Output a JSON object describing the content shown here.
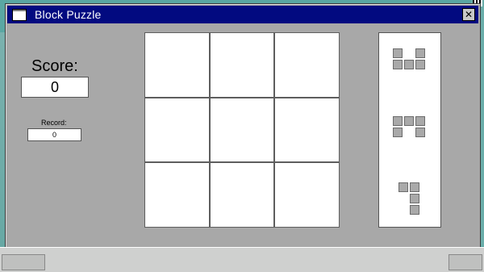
{
  "window": {
    "title": "Block Puzzle",
    "close_glyph": "✕"
  },
  "score": {
    "label": "Score:",
    "value": "0"
  },
  "record": {
    "label": "Record:",
    "value": "0"
  },
  "board": {
    "rows": 3,
    "cols": 3,
    "filled": [
      [
        false,
        false,
        false
      ],
      [
        false,
        false,
        false
      ],
      [
        false,
        false,
        false
      ]
    ]
  },
  "pieces": [
    {
      "name": "piece-1",
      "cells": [
        [
          0,
          0
        ],
        [
          0,
          2
        ],
        [
          1,
          0
        ],
        [
          1,
          1
        ],
        [
          1,
          2
        ]
      ]
    },
    {
      "name": "piece-2",
      "cells": [
        [
          0,
          0
        ],
        [
          0,
          1
        ],
        [
          0,
          2
        ],
        [
          1,
          0
        ],
        [
          1,
          2
        ]
      ]
    },
    {
      "name": "piece-3",
      "cells": [
        [
          0,
          0
        ],
        [
          0,
          1
        ],
        [
          1,
          1
        ],
        [
          2,
          1
        ]
      ]
    }
  ],
  "colors": {
    "titlebar": "#020a80",
    "window_bg": "#a8a8a8",
    "desktop": "#5aa7a3",
    "block": "#a9a9a9"
  },
  "icons": {
    "window_icon": "window-icon",
    "close_icon": "close-icon"
  }
}
